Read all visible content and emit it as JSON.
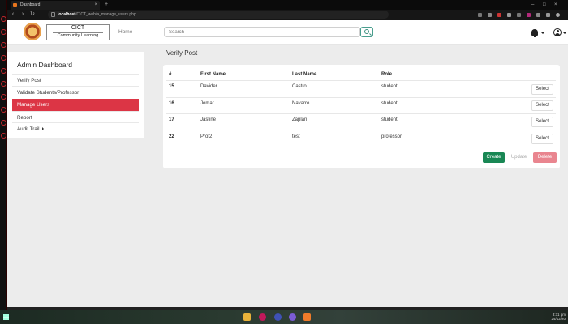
{
  "browser": {
    "tab_title": "Dashboard",
    "tab_close": "×",
    "new_tab": "+",
    "url_host": "localhost",
    "url_path": "/CICT_web/a_manage_users.php",
    "window_controls": [
      "–",
      "□",
      "×"
    ]
  },
  "header": {
    "logo_title": "CICT",
    "logo_subtitle": "Community Learning",
    "nav_home": "Home",
    "search_placeholder": "Search"
  },
  "sidebar": {
    "title": "Admin Dashboard",
    "items": [
      {
        "label": "Verify Post"
      },
      {
        "label": "Validate Students/Professor"
      },
      {
        "label": "Manage Users",
        "active": true
      },
      {
        "label": "Report"
      },
      {
        "label": "Audit Trail"
      }
    ]
  },
  "main": {
    "title": "Verify Post",
    "table": {
      "headers": [
        "#",
        "First Name",
        "Last Name",
        "Role"
      ],
      "rows": [
        {
          "id": "15",
          "first": "Davider",
          "last": "Castro",
          "role": "student",
          "action": "Select"
        },
        {
          "id": "16",
          "first": "Jomar",
          "last": "Navarro",
          "role": "student",
          "action": "Select"
        },
        {
          "id": "17",
          "first": "Jastine",
          "last": "Zaplan",
          "role": "student",
          "action": "Select"
        },
        {
          "id": "22",
          "first": "Prof2",
          "last": "test",
          "role": "professor",
          "action": "Select"
        }
      ]
    },
    "buttons": {
      "create": "Create",
      "update": "Update",
      "delete": "Delete"
    }
  },
  "taskbar": {
    "time": "3:31 pm",
    "date": "24/12/20"
  },
  "colors": {
    "active_item": "#dc3545",
    "create_button": "#198754",
    "delete_button": "#e9858f",
    "search_button_border": "#4a9e8e"
  }
}
